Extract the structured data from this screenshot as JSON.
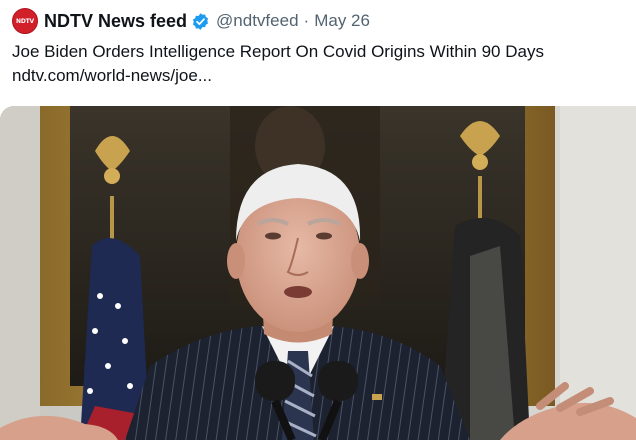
{
  "tweet": {
    "author_name": "NDTV News feed",
    "avatar_text": "NDTV",
    "handle": "@ndtvfeed",
    "separator": "·",
    "date": "May 26",
    "text": "Joe Biden Orders Intelligence Report On Covid Origins Within 90 Days",
    "link": "ndtv.com/world-news/joe...",
    "verified_icon": "verified-badge-icon"
  },
  "colors": {
    "avatar_bg": "#d2202b",
    "verified": "#1d9bf0",
    "secondary_text": "#536471"
  }
}
